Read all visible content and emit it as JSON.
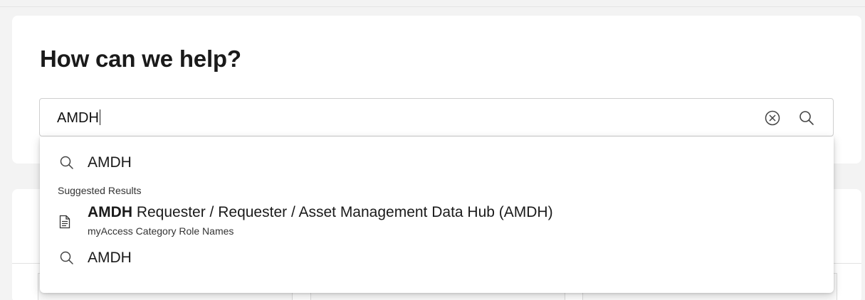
{
  "page": {
    "heading": "How can we help?"
  },
  "search": {
    "value": "AMDH",
    "clear_icon": "circle-x-icon",
    "search_icon": "search-icon"
  },
  "dropdown": {
    "query_suggestion_1": "AMDH",
    "suggested_heading": "Suggested Results",
    "result": {
      "icon": "document-icon",
      "title_bold": "AMDH",
      "title_rest": " Requester / Requester / Asset Management Data Hub (AMDH)",
      "subtitle": "myAccess Category Role Names"
    },
    "query_suggestion_2": "AMDH"
  },
  "colors": {
    "background": "#f3f3f3",
    "card": "#ffffff",
    "border": "#cfcfcf",
    "text": "#1a1a1a"
  }
}
